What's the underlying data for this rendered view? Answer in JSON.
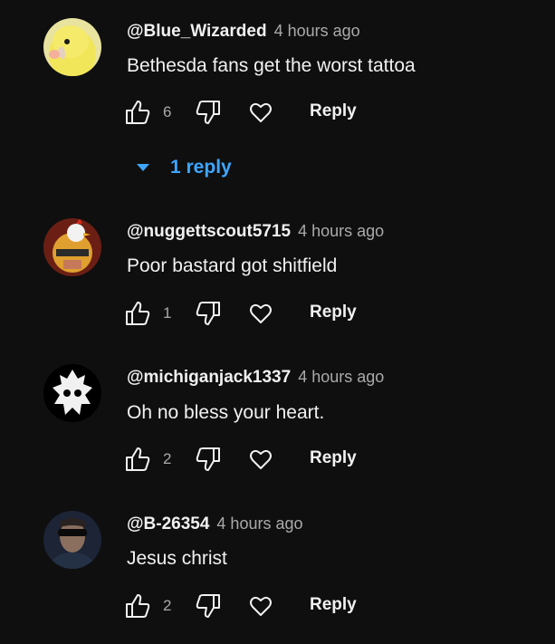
{
  "comments": [
    {
      "author": "@Blue_Wizarded",
      "time": "4 hours ago",
      "text": "Bethesda fans get the worst tattoa",
      "likes": "6",
      "reply_label": "Reply",
      "avatar_icon": "yellow-bird-avatar"
    },
    {
      "author": "@nuggettscout5715",
      "time": "4 hours ago",
      "text": "Poor bastard got shitfield",
      "likes": "1",
      "reply_label": "Reply",
      "avatar_icon": "helmet-chicken-avatar"
    },
    {
      "author": "@michiganjack1337",
      "time": "4 hours ago",
      "text": "Oh no bless your heart.",
      "likes": "2",
      "reply_label": "Reply",
      "avatar_icon": "white-logo-avatar"
    },
    {
      "author": "@B-26354",
      "time": "4 hours ago",
      "text": "Jesus christ",
      "likes": "2",
      "reply_label": "Reply",
      "avatar_icon": "sunglasses-man-avatar"
    }
  ],
  "replies_toggle": {
    "label": "1 reply",
    "icon": "caret-down-icon"
  },
  "colors": {
    "background": "#0f0f0f",
    "text": "#f1f1f1",
    "muted": "#aaaaaa",
    "link": "#3ea6ff"
  }
}
